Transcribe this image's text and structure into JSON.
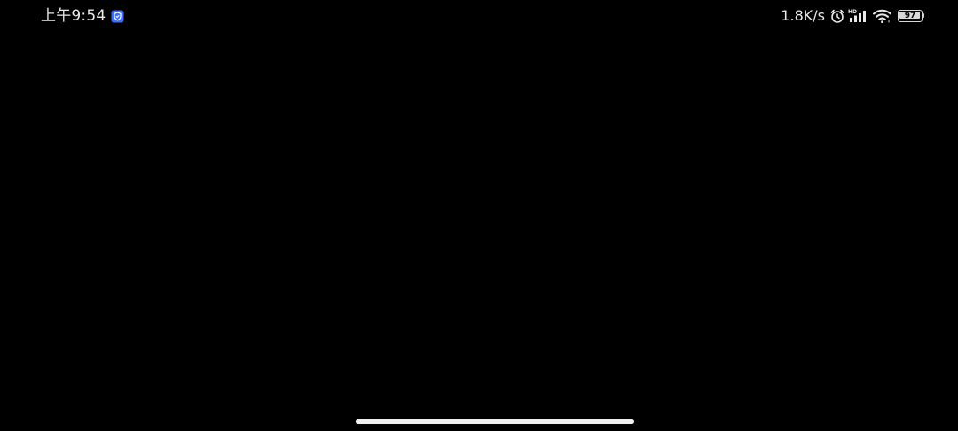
{
  "status_bar": {
    "time": "上午9:54",
    "network_speed": "1.8K/s",
    "battery_level": "97",
    "battery_fraction": 0.97,
    "signal_label": "HD",
    "icons": {
      "left": [
        "security-shield-icon"
      ],
      "right": [
        "alarm-icon",
        "cellular-signal-icon",
        "wifi-icon",
        "battery-icon"
      ]
    }
  },
  "colors": {
    "background": "#000000",
    "status_text": "#e9e9e9",
    "shield_badge": "#3d6ef5",
    "home_indicator": "#f0f0f0"
  }
}
